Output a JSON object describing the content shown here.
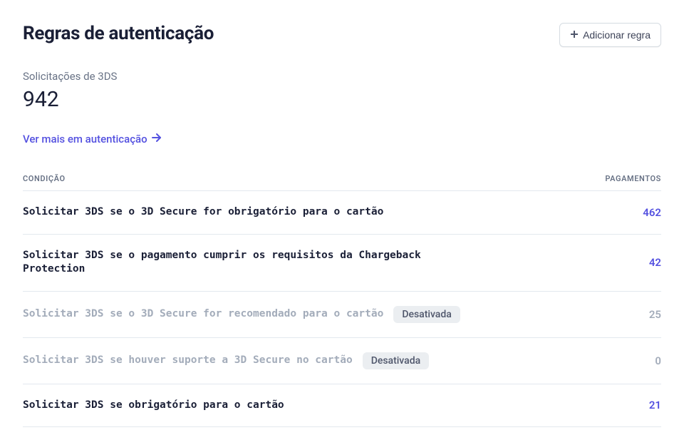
{
  "header": {
    "title": "Regras de autenticação",
    "add_button_label": "Adicionar regra"
  },
  "metric": {
    "label": "Solicitações de 3DS",
    "value": "942"
  },
  "link_more": "Ver mais em autenticação",
  "columns": {
    "condition": "CONDIÇÃO",
    "payments": "PAGAMENTOS"
  },
  "badge_disabled": "Desativada",
  "rules": [
    {
      "text": "Solicitar 3DS se o 3D Secure for obrigatório para o cartão",
      "count": "462",
      "disabled": false
    },
    {
      "text": "Solicitar 3DS se o pagamento cumprir os requisitos da Chargeback Protection",
      "count": "42",
      "disabled": false
    },
    {
      "text": "Solicitar 3DS se o 3D Secure for recomendado para o cartão",
      "count": "25",
      "disabled": true
    },
    {
      "text": "Solicitar 3DS se houver suporte a 3D Secure no cartão",
      "count": "0",
      "disabled": true
    },
    {
      "text": "Solicitar 3DS se obrigatório para o cartão",
      "count": "21",
      "disabled": false
    }
  ]
}
